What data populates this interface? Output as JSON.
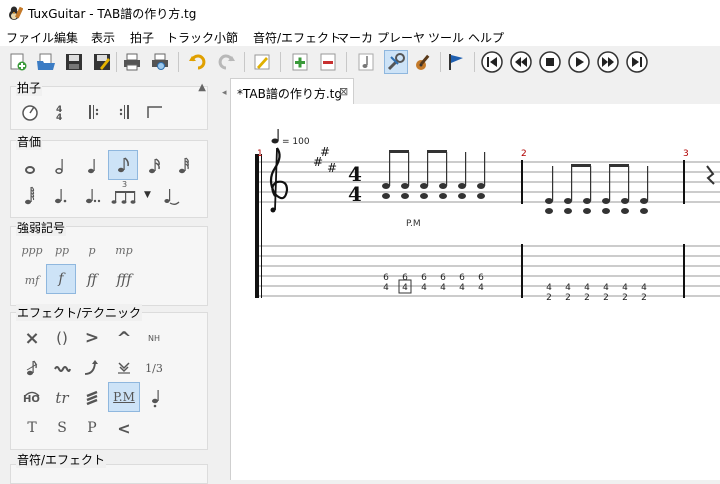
{
  "window": {
    "title": "TuxGuitar - TAB譜の作り方.tg"
  },
  "menu": [
    "ファイル",
    "編集",
    "表示",
    "拍子",
    "トラック",
    "小節",
    "音符/エフェクト",
    "マーカ",
    "プレーヤ",
    "ツール",
    "ヘルプ"
  ],
  "toolbar": {
    "buttons": [
      "new-file-icon",
      "open-file-icon",
      "save-icon",
      "save-as-icon",
      "print-icon",
      "print-preview-icon",
      "undo-icon",
      "redo-icon",
      "edit-pencil-icon",
      "add-track-icon",
      "remove-track-icon",
      "note-view-icon",
      "settings-wrench-icon",
      "guitar-icon",
      "flag-icon",
      "first-icon",
      "previous-icon",
      "stop-icon",
      "play-icon",
      "next-icon",
      "last-icon"
    ]
  },
  "panels": {
    "time": {
      "title": "拍子"
    },
    "duration": {
      "title": "音価",
      "tuplet": "3"
    },
    "dynamics": {
      "title": "強弱記号",
      "row1": [
        "ppp",
        "pp",
        "p",
        "mp"
      ],
      "row2": [
        "mf",
        "f",
        "ff",
        "fff"
      ]
    },
    "effects": {
      "title": "エフェクト/テクニック",
      "row1": [
        "×",
        "()",
        ">",
        "^",
        "NH"
      ],
      "row3": [
        "HO",
        "tr",
        "",
        "P.M",
        ""
      ],
      "row4": [
        "T",
        "S",
        "P",
        "<"
      ],
      "third": "1/3"
    },
    "note_effects": {
      "title": "音符/エフェクト"
    }
  },
  "document": {
    "tab_label": "*TAB譜の作り方.tg"
  },
  "score": {
    "tempo": "= 100",
    "time_signature": [
      "4",
      "4"
    ],
    "measure_numbers": [
      "1",
      "2",
      "3"
    ],
    "palm_mute": "P.M",
    "measure1_tab": {
      "string2": [
        "6",
        "6",
        "6",
        "6",
        "6",
        "6"
      ],
      "string3": [
        "4",
        "4",
        "4",
        "4",
        "4",
        "4"
      ]
    },
    "measure2_tab": {
      "string3": [
        "4",
        "4",
        "4",
        "4",
        "4",
        "4"
      ],
      "string4": [
        "2",
        "2",
        "2",
        "2",
        "2",
        "2"
      ]
    },
    "colors": {
      "measure_number": "#b00000",
      "note": "#333333"
    }
  }
}
